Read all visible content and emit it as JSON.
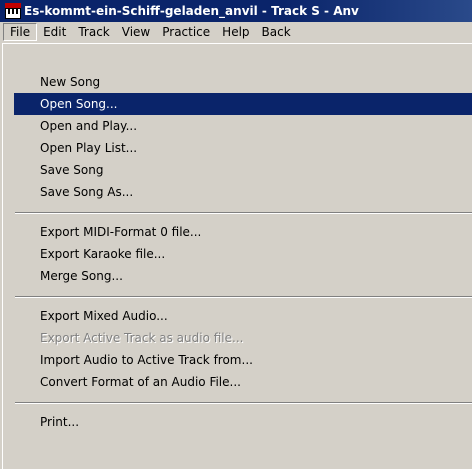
{
  "window": {
    "title": "Es-kommt-ein-Schiff-geladen_anvil - Track S - Anv"
  },
  "menubar": [
    {
      "label": "File"
    },
    {
      "label": "Edit"
    },
    {
      "label": "Track"
    },
    {
      "label": "View"
    },
    {
      "label": "Practice"
    },
    {
      "label": "Help"
    },
    {
      "label": "Back"
    }
  ],
  "file_menu": {
    "items": [
      {
        "label": "New Song"
      },
      {
        "label": "Open Song...",
        "highlighted": true
      },
      {
        "label": "Open and Play..."
      },
      {
        "label": "Open Play List..."
      },
      {
        "label": "Save Song"
      },
      {
        "label": "Save Song As..."
      },
      {
        "label": "Export MIDI-Format 0 file..."
      },
      {
        "label": "Export Karaoke file..."
      },
      {
        "label": "Merge Song..."
      },
      {
        "label": "Export Mixed Audio..."
      },
      {
        "label": "Export Active Track as audio file...",
        "disabled": true
      },
      {
        "label": "Import Audio to Active Track from..."
      },
      {
        "label": "Convert Format of an Audio File..."
      },
      {
        "label": "Print..."
      }
    ]
  },
  "icons": {
    "app": "piano-keyboard-icon"
  },
  "colors": {
    "titlebar": "#0a246a",
    "highlight": "#0a246a",
    "menu_bg": "#d4d0c8",
    "disabled_text": "#808080"
  }
}
